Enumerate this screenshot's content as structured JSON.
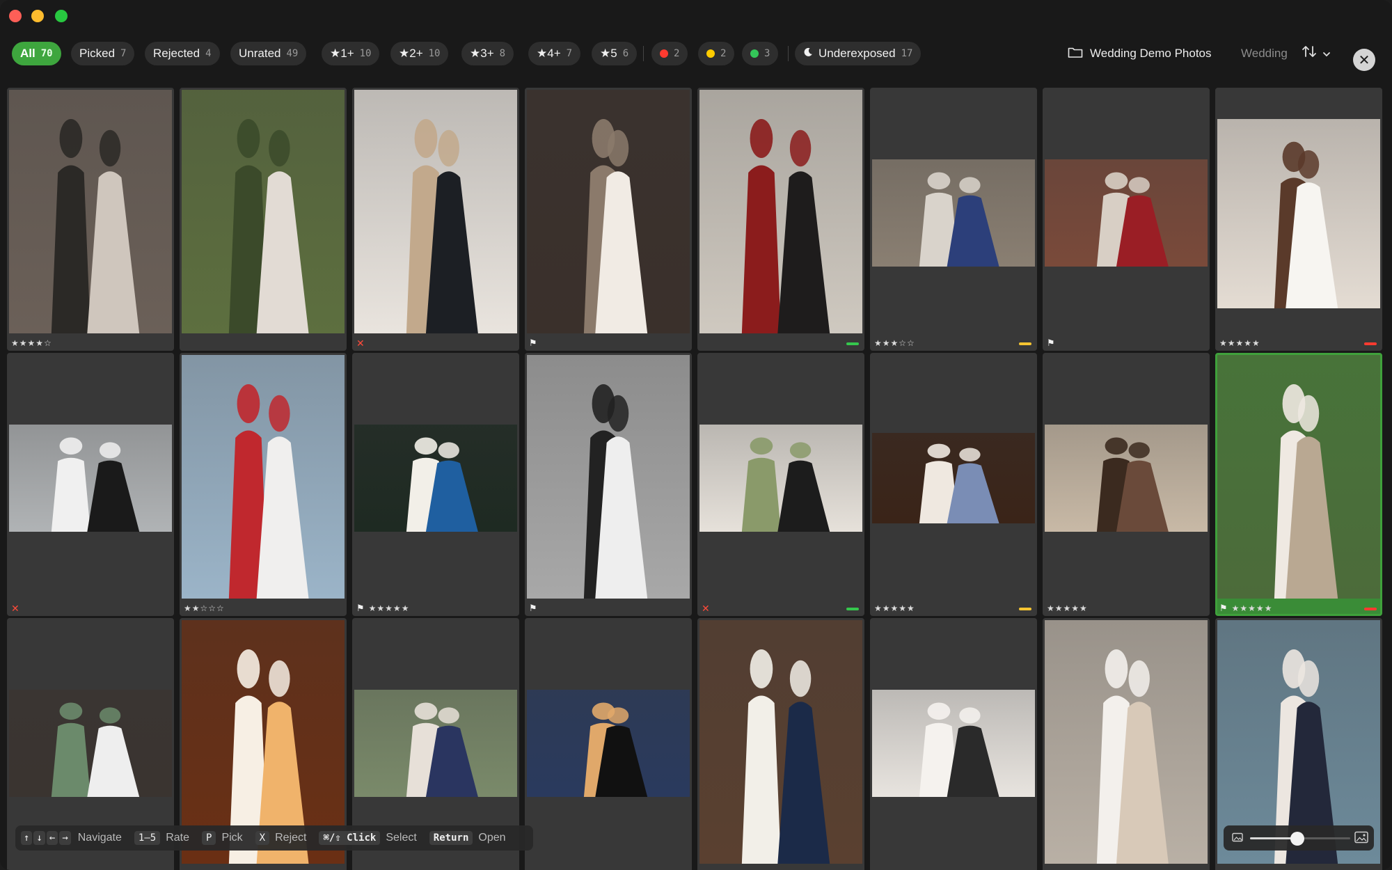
{
  "filters": [
    {
      "id": "all",
      "label": "All",
      "count": "70",
      "active": true
    },
    {
      "id": "picked",
      "label": "Picked",
      "count": "7"
    },
    {
      "id": "rejected",
      "label": "Rejected",
      "count": "4"
    },
    {
      "id": "unrated",
      "label": "Unrated",
      "count": "49"
    },
    {
      "id": "star1",
      "label": "★1+",
      "count": "10"
    },
    {
      "id": "star2",
      "label": "★2+",
      "count": "10"
    },
    {
      "id": "star3",
      "label": "★3+",
      "count": "8"
    },
    {
      "id": "star4",
      "label": "★4+",
      "count": "7"
    },
    {
      "id": "star5",
      "label": "★5",
      "count": "6"
    }
  ],
  "color_filters": [
    {
      "id": "red",
      "color": "#ff3b30",
      "count": "2"
    },
    {
      "id": "yellow",
      "color": "#ffcc00",
      "count": "2"
    },
    {
      "id": "green",
      "color": "#34c759",
      "count": "3"
    }
  ],
  "exposure_filter": {
    "label": "Underexposed",
    "count": "17",
    "icon": "moon-icon"
  },
  "folder": {
    "label": "Wedding Demo Photos",
    "icon": "folder-icon"
  },
  "collection": {
    "label": "Wedding"
  },
  "sort": {
    "icon": "sort-arrows-icon"
  },
  "close": {
    "icon": "close-icon",
    "glyph": "✕"
  },
  "label_colors": {
    "green": "#35c74d",
    "yellow": "#f5c431",
    "red": "#ff3b30"
  },
  "photos": [
    {
      "rating": 4,
      "flag": "none",
      "color": null,
      "selected": false,
      "tone": [
        "#6b6058",
        "#cfc6bd",
        "#2b2926"
      ]
    },
    {
      "rating": 0,
      "flag": "none",
      "color": null,
      "selected": false,
      "tone": [
        "#5d6f3f",
        "#e2dbd4",
        "#3b4a2a"
      ]
    },
    {
      "rating": 0,
      "flag": "reject",
      "color": null,
      "selected": false,
      "tone": [
        "#e9e4de",
        "#1c1f24",
        "#c2a98c"
      ]
    },
    {
      "rating": 0,
      "flag": "pick",
      "color": null,
      "selected": false,
      "tone": [
        "#3a302b",
        "#f1ebe4",
        "#8b7a6b"
      ]
    },
    {
      "rating": 0,
      "flag": "none",
      "color": "green",
      "selected": false,
      "tone": [
        "#cfc9c0",
        "#1e1c1c",
        "#8b1c1c"
      ]
    },
    {
      "rating": 3,
      "flag": "none",
      "color": "yellow",
      "selected": false,
      "tone": [
        "#8a7f72",
        "#2c3f7a",
        "#d9d3cb"
      ]
    },
    {
      "rating": 0,
      "flag": "pick",
      "color": null,
      "selected": false,
      "tone": [
        "#7a4a3a",
        "#9a1e25",
        "#d8cfc5"
      ]
    },
    {
      "rating": 5,
      "flag": "none",
      "color": "red",
      "selected": false,
      "tone": [
        "#e4dcd3",
        "#f7f5f1",
        "#5a3a2a"
      ]
    },
    {
      "rating": 0,
      "flag": "reject",
      "color": null,
      "selected": false,
      "tone": [
        "#b0b3b5",
        "#1a1a1a",
        "#f0f0f0"
      ]
    },
    {
      "rating": 2,
      "flag": "none",
      "color": null,
      "selected": false,
      "tone": [
        "#9bb4c8",
        "#f0efee",
        "#c0282e"
      ]
    },
    {
      "rating": 5,
      "flag": "pick",
      "color": null,
      "selected": false,
      "tone": [
        "#1e2a22",
        "#1f5fa0",
        "#f2efe8"
      ]
    },
    {
      "rating": 0,
      "flag": "pick",
      "color": null,
      "selected": false,
      "tone": [
        "#a8a8a8",
        "#eeeeee",
        "#222222"
      ]
    },
    {
      "rating": 0,
      "flag": "reject",
      "color": "green",
      "selected": false,
      "tone": [
        "#e6e1da",
        "#1c1c1c",
        "#8a9a6a"
      ]
    },
    {
      "rating": 5,
      "flag": "none",
      "color": "yellow",
      "selected": false,
      "tone": [
        "#3a2418",
        "#7a8db5",
        "#efe8e0"
      ]
    },
    {
      "rating": 5,
      "flag": "none",
      "color": null,
      "selected": false,
      "tone": [
        "#c8b9a6",
        "#6a4a3a",
        "#3b2a1f"
      ]
    },
    {
      "rating": 5,
      "flag": "pick",
      "color": "red",
      "selected": true,
      "tone": [
        "#4c6b3a",
        "#b9a892",
        "#efe9e2"
      ]
    },
    {
      "rating": 0,
      "flag": "none",
      "color": null,
      "selected": false,
      "tone": [
        "#3a3430",
        "#eeeeee",
        "#6b8a6b"
      ]
    },
    {
      "rating": 0,
      "flag": "none",
      "color": null,
      "selected": false,
      "tone": [
        "#6a2f14",
        "#f0b36b",
        "#f7efe4"
      ]
    },
    {
      "rating": 0,
      "flag": "none",
      "color": null,
      "selected": false,
      "tone": [
        "#7a8a6a",
        "#2a3560",
        "#e7e0d8"
      ]
    },
    {
      "rating": 0,
      "flag": "none",
      "color": null,
      "selected": false,
      "tone": [
        "#2a3a5e",
        "#111111",
        "#e0a86a"
      ]
    },
    {
      "rating": 0,
      "flag": "none",
      "color": null,
      "selected": false,
      "tone": [
        "#5a4030",
        "#1b2a48",
        "#f2efe8"
      ]
    },
    {
      "rating": 0,
      "flag": "none",
      "color": null,
      "selected": false,
      "tone": [
        "#e8e4df",
        "#2a2a2a",
        "#f5f2ee"
      ]
    },
    {
      "rating": 0,
      "flag": "none",
      "color": null,
      "selected": false,
      "tone": [
        "#b9b0a5",
        "#d8c9b8",
        "#f3f0ec"
      ]
    },
    {
      "rating": 0,
      "flag": "none",
      "color": null,
      "selected": false,
      "tone": [
        "#6d8a9a",
        "#23283a",
        "#ece6e0"
      ]
    }
  ],
  "shortcuts": [
    {
      "keys": [
        "↑",
        "↓",
        "←",
        "→"
      ],
      "label": "Navigate"
    },
    {
      "keys": [
        "1–5"
      ],
      "label": "Rate"
    },
    {
      "keys": [
        "P"
      ],
      "label": "Pick"
    },
    {
      "keys": [
        "X"
      ],
      "label": "Reject"
    },
    {
      "keys": [
        "⌘/⇧ Click"
      ],
      "label": "Select",
      "bold": true
    },
    {
      "keys": [
        "Return"
      ],
      "label": "Open",
      "bold": true
    }
  ],
  "zoom": {
    "level": 0.47,
    "small_icon": "image-small-icon",
    "large_icon": "image-large-icon"
  }
}
